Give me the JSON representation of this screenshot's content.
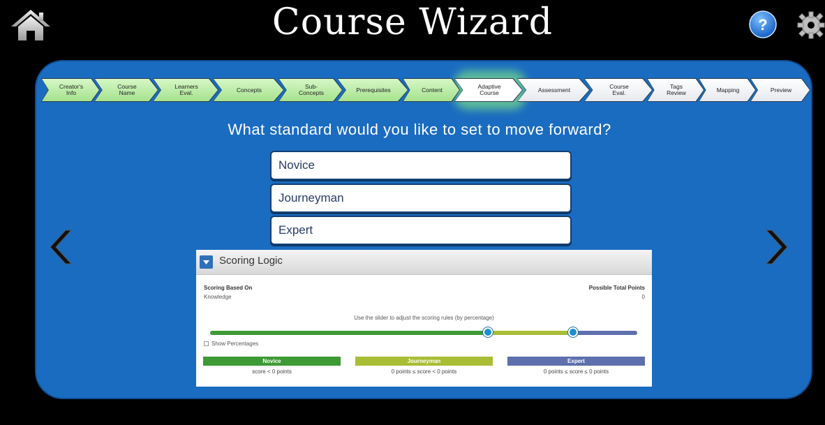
{
  "header": {
    "title": "Course Wizard",
    "icons": {
      "home": "home-icon",
      "help": "help-icon",
      "settings": "gear-icon"
    }
  },
  "steps": [
    {
      "line1": "Creator's",
      "line2": "Info",
      "state": "done"
    },
    {
      "line1": "Course",
      "line2": "Name",
      "state": "done"
    },
    {
      "line1": "Learners",
      "line2": "Eval.",
      "state": "done"
    },
    {
      "line1": "Concepts",
      "line2": "",
      "state": "done"
    },
    {
      "line1": "Sub-",
      "line2": "Concepts",
      "state": "done"
    },
    {
      "line1": "Prerequisites",
      "line2": "",
      "state": "done"
    },
    {
      "line1": "Content",
      "line2": "",
      "state": "done"
    },
    {
      "line1": "Adaptive",
      "line2": "Course",
      "state": "active"
    },
    {
      "line1": "Assessment",
      "line2": "",
      "state": "todo"
    },
    {
      "line1": "Course",
      "line2": "Eval.",
      "state": "todo"
    },
    {
      "line1": "Tags",
      "line2": "Review",
      "state": "todo"
    },
    {
      "line1": "Mapping",
      "line2": "",
      "state": "todo"
    },
    {
      "line1": "Preview",
      "line2": "",
      "state": "todo"
    }
  ],
  "question": "What standard would you like to set to move forward?",
  "options": [
    "Novice",
    "Journeyman",
    "Expert"
  ],
  "scoring": {
    "title": "Scoring Logic",
    "based_on_label": "Scoring Based On",
    "based_on_value": "Knowledge",
    "total_label": "Possible Total Points",
    "total_value": "0",
    "slider_hint": "Use the slider to adjust the scoring rules (by percentage)",
    "show_percentages": "Show Percentages",
    "thresholds": [
      0.65,
      0.85
    ],
    "levels": [
      {
        "name": "Novice",
        "rule": "score < 0 points",
        "color": "#3e9a35"
      },
      {
        "name": "Journeyman",
        "rule": "0 points ≤ score < 0 points",
        "color": "#a9bd35"
      },
      {
        "name": "Expert",
        "rule": "0 points ≤ score ≤ 0 points",
        "color": "#5e6fae"
      }
    ]
  },
  "colors": {
    "panel": "#1a6cc0",
    "background": "#000000"
  }
}
